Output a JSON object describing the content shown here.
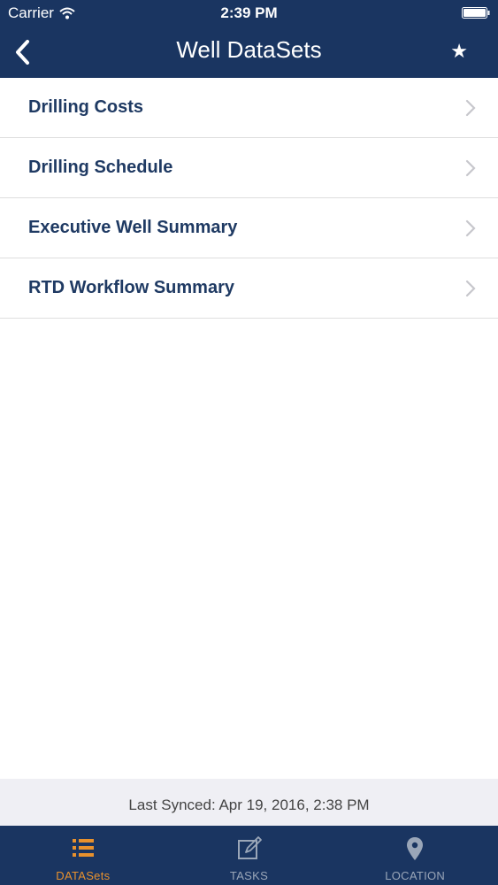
{
  "status_bar": {
    "carrier": "Carrier",
    "time": "2:39 PM",
    "wifi_icon": "wifi-icon",
    "battery_icon": "battery-icon"
  },
  "navbar": {
    "title": "Well DataSets",
    "back_icon": "chevron-left-icon",
    "favorite_icon": "star-icon"
  },
  "list": {
    "items": [
      {
        "label": "Drilling Costs"
      },
      {
        "label": "Drilling Schedule"
      },
      {
        "label": "Executive Well Summary"
      },
      {
        "label": "RTD Workflow Summary"
      }
    ],
    "chevron_icon": "chevron-right-icon"
  },
  "sync": {
    "text": "Last Synced: Apr 19, 2016, 2:38 PM"
  },
  "tabbar": {
    "tabs": [
      {
        "label": "DATASets",
        "icon": "list-icon",
        "active": true
      },
      {
        "label": "TASKS",
        "icon": "edit-icon",
        "active": false
      },
      {
        "label": "LOCATION",
        "icon": "location-pin-icon",
        "active": false
      }
    ]
  },
  "colors": {
    "brand": "#1a3561",
    "accent": "#e8912d",
    "text": "#1f3a63",
    "inactive": "#9aa6b8"
  }
}
